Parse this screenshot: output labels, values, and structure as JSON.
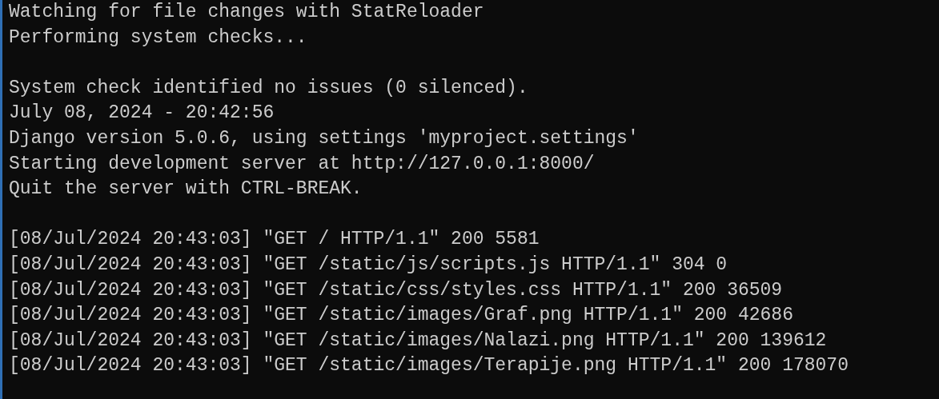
{
  "console": {
    "blocks": [
      [
        "Watching for file changes with StatReloader",
        "Performing system checks..."
      ],
      [
        "System check identified no issues (0 silenced).",
        "July 08, 2024 - 20:42:56",
        "Django version 5.0.6, using settings 'myproject.settings'",
        "Starting development server at http://127.0.0.1:8000/",
        "Quit the server with CTRL-BREAK."
      ],
      [
        "[08/Jul/2024 20:43:03] \"GET / HTTP/1.1\" 200 5581",
        "[08/Jul/2024 20:43:03] \"GET /static/js/scripts.js HTTP/1.1\" 304 0",
        "[08/Jul/2024 20:43:03] \"GET /static/css/styles.css HTTP/1.1\" 200 36509",
        "[08/Jul/2024 20:43:03] \"GET /static/images/Graf.png HTTP/1.1\" 200 42686",
        "[08/Jul/2024 20:43:03] \"GET /static/images/Nalazi.png HTTP/1.1\" 200 139612",
        "[08/Jul/2024 20:43:03] \"GET /static/images/Terapije.png HTTP/1.1\" 200 178070"
      ]
    ]
  }
}
